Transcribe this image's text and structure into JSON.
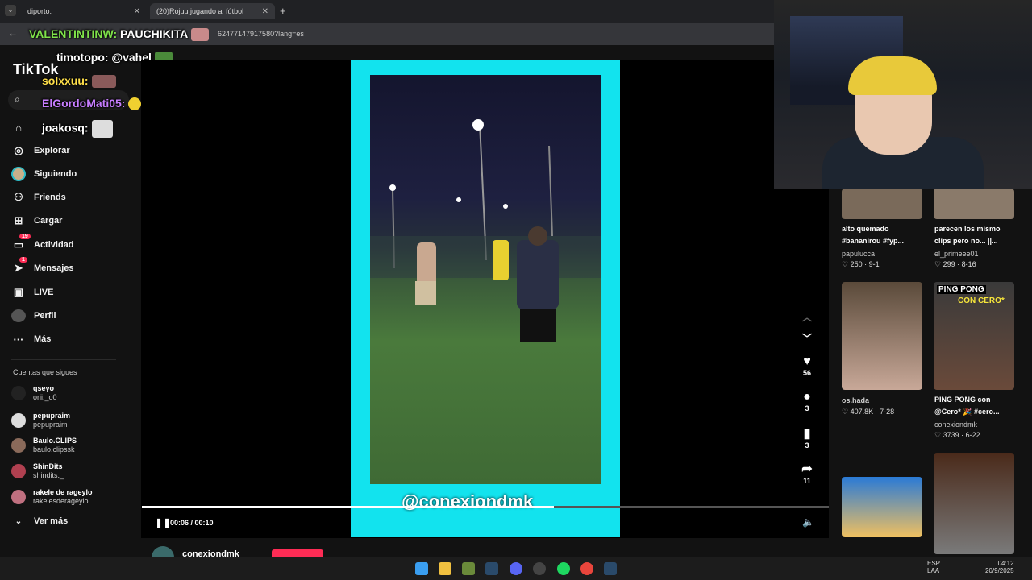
{
  "browser": {
    "tab1_title": "diporto:",
    "tab2_title": "(20)Rojuu jugando al fútbol",
    "url": "62477147917580?lang=es"
  },
  "chat": [
    {
      "user": "VALENTINTINW:",
      "msg": "PAUCHIKITA",
      "color": "#7fe34a"
    },
    {
      "user": "timotopo:",
      "msg": "@vahel",
      "color": "#ffffff"
    },
    {
      "user": "solxxuu:",
      "msg": "",
      "color": "#ffe04a"
    },
    {
      "user": "ElGordoMati05:",
      "msg": "",
      "color": "#c77dff"
    },
    {
      "user": "joakosq:",
      "msg": "",
      "color": "#ffffff"
    }
  ],
  "sidebar": {
    "logo": "TikTok",
    "nav": [
      {
        "label": "Explorar",
        "icon": "compass-icon"
      },
      {
        "label": "Siguiendo",
        "icon": "avatar-icon"
      },
      {
        "label": "Friends",
        "icon": "friends-icon"
      },
      {
        "label": "Cargar",
        "icon": "upload-icon"
      },
      {
        "label": "Actividad",
        "icon": "inbox-icon",
        "badge": "19"
      },
      {
        "label": "Mensajes",
        "icon": "send-icon",
        "badge": "1"
      },
      {
        "label": "LIVE",
        "icon": "live-icon"
      },
      {
        "label": "Perfil",
        "icon": "profile-icon"
      },
      {
        "label": "Más",
        "icon": "more-icon"
      }
    ],
    "following_title": "Cuentas que sigues",
    "following": [
      {
        "name": "qseyo",
        "handle": "orii._o0"
      },
      {
        "name": "pepupraim",
        "handle": "pepupraim"
      },
      {
        "name": "Baulo.CLIPS",
        "handle": "baulo.clipssk"
      },
      {
        "name": "ShinDits",
        "handle": "shindits._"
      },
      {
        "name": "rakele de rageylo",
        "handle": "rakelesderageylo"
      }
    ],
    "see_more": "Ver más"
  },
  "player": {
    "overlay_text": "@conexiondmk",
    "time": "00:06 / 00:10",
    "progress": 0.6,
    "author": "conexiondmk",
    "likes": "56",
    "comments": "3",
    "saves": "3",
    "shares": "11"
  },
  "recommended": [
    {
      "title": "alto quemado #bananirou #fyp...",
      "user": "papulucca",
      "meta": "♡ 250 · 9-1"
    },
    {
      "title": "parecen los mismo clips pero no... ||...",
      "user": "el_primeee01",
      "meta": "♡ 299 · 8-16"
    },
    {
      "title": "",
      "user": "os.hada",
      "meta": "♡ 407.8K · 7-28"
    },
    {
      "title": "PING PONG con @Cero* 🎉 #cero...",
      "user": "conexiondmk",
      "meta": "♡ 3739 · 6-22",
      "thumb_text_1": "PING PONG",
      "thumb_text_2": "CON CERO*"
    }
  ],
  "taskbar": {
    "lang": "ESP",
    "lang2": "LAA",
    "time": "04:12",
    "date": "20/9/2025"
  },
  "colors": {
    "accent": "#fe2c55",
    "frame": "#12e3ee"
  }
}
